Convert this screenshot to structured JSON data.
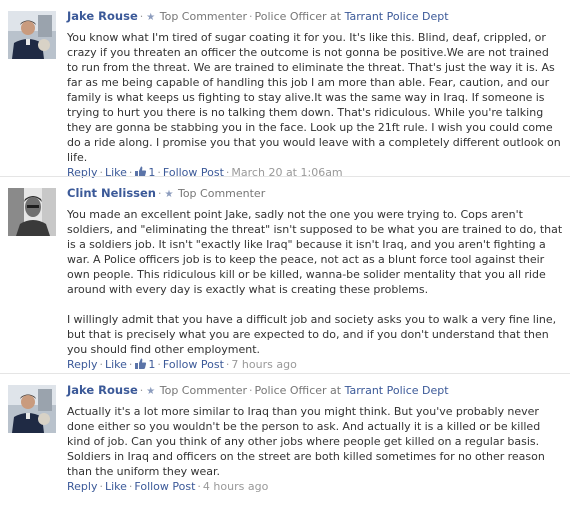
{
  "comments": [
    {
      "author": "Jake Rouse",
      "badge": "Top Commenter",
      "occupation": "Police Officer",
      "at": "at",
      "employer": "Tarrant Police Dept",
      "paragraphs": [
        "You know what I'm tired of sugar coating it for you. It's like this. Blind, deaf, crippled, or crazy if you threaten an officer the outcome is not gonna be positive.We are not trained to run from the threat. We are trained to eliminate the threat. That's just the way it is. As far as me being capable of handling this job I am more than able. Fear, caution, and our family is what keeps us fighting to stay alive.It was the same way in Iraq. If someone is trying to hurt you there is no talking them down. That's ridiculous. While you're talking they are gonna be stabbing you in the face. Look up the 21ft rule. I wish you could come do a ride along. I promise you that you would leave with a completely different outlook on life."
      ],
      "actions": {
        "reply": "Reply",
        "like": "Like",
        "like_count": "1",
        "follow": "Follow Post",
        "time": "March 20 at 1:06am"
      }
    },
    {
      "author": "Clint Nelissen",
      "badge": "Top Commenter",
      "paragraphs": [
        "You made an excellent point Jake, sadly not the one you were trying to. Cops aren't soldiers, and \"eliminating the threat\" isn't supposed to be what you are trained to do, that is a soldiers job. It isn't \"exactly like Iraq\" because it isn't Iraq, and you aren't fighting a war. A Police officers job is to keep the peace, not act as a blunt force tool against their own people. This ridiculous kill or be killed, wanna-be solider mentality that you all ride around with every day is exactly what is creating these problems.",
        "I willingly admit that you have a difficult job and society asks you to walk a very fine line, but that is precisely what you are expected to do, and if you don't understand that then you should find other employment."
      ],
      "actions": {
        "reply": "Reply",
        "like": "Like",
        "like_count": "1",
        "follow": "Follow Post",
        "time": "7 hours ago"
      }
    },
    {
      "author": "Jake Rouse",
      "badge": "Top Commenter",
      "occupation": "Police Officer",
      "at": "at",
      "employer": "Tarrant Police Dept",
      "paragraphs": [
        "Actually it's a lot more similar to Iraq than you might think. But you've probably never done either so you wouldn't be the person to ask. And actually it is a killed or be killed kind of job. Can you think of any other jobs where people get killed on a regular basis. Soldiers in Iraq and officers on the street are both killed sometimes for no other reason than the uniform they wear."
      ],
      "actions": {
        "reply": "Reply",
        "like": "Like",
        "follow": "Follow Post",
        "time": "4 hours ago"
      }
    }
  ],
  "colors": {
    "link": "#3b5998",
    "text": "#333333",
    "meta": "#999999"
  }
}
